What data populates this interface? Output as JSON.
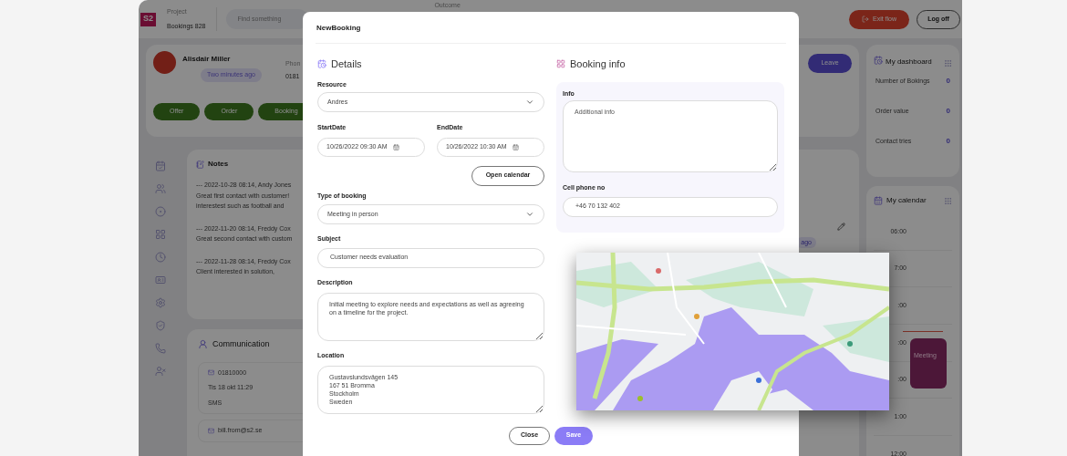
{
  "topbar": {
    "logo": "S2",
    "project_label": "Project",
    "project_name": "Bookings 828",
    "search": {
      "placeholder": "Find something"
    },
    "outcome_label": "Outcome",
    "exit_button": "Exit flow",
    "logoff_button": "Log off"
  },
  "customer": {
    "name": "Alisdair Miller",
    "badge": "Two minutes ago",
    "phone_label": "Phon",
    "phone": "0181",
    "leave_button": "Leave",
    "actions": [
      {
        "label": "Offer"
      },
      {
        "label": "Order"
      },
      {
        "label": "Booking"
      }
    ]
  },
  "notes": {
    "title": "Notes",
    "entries": [
      {
        "header": "--- 2022-10-28 08:14, Andy Jones",
        "lines": [
          "Great first contact with customer!",
          "interestest such as football and"
        ]
      },
      {
        "header": "--- 2022-11-20 08:14, Freddy Cox",
        "lines": [
          "Great second contact with custom"
        ]
      },
      {
        "header": "--- 2022-11-28 08:14, Freddy Cox",
        "lines": [
          "Client interested in solution,"
        ]
      }
    ]
  },
  "side_panel": {
    "badge": "ago"
  },
  "communication": {
    "title": "Communication",
    "items": [
      {
        "contact": "01810000",
        "time": "Tis 18 okt 11:29",
        "channel": "SMS"
      },
      {
        "contact": "bill.from@s2.se"
      }
    ]
  },
  "dashboard": {
    "title": "My dashboard",
    "stats": [
      {
        "label": "Number of Bokings",
        "value": "0"
      },
      {
        "label": "Order value",
        "value": "0"
      },
      {
        "label": "Contact tries",
        "value": "0"
      }
    ]
  },
  "calendar": {
    "title": "My calendar",
    "times": [
      "06:00",
      "7:00",
      ":00",
      ":00",
      ":00",
      "1:00",
      "12:00"
    ],
    "events": [
      {
        "title": "Meeting"
      }
    ]
  },
  "modal": {
    "title": "NewBooking",
    "details": {
      "heading": "Details",
      "resource": {
        "label": "Resource",
        "value": "Andres"
      },
      "start_date": {
        "label": "StartDate",
        "value": "10/26/2022 09:30 AM"
      },
      "end_date": {
        "label": "EndDate",
        "value": "10/26/2022 10:30 AM"
      },
      "open_calendar_button": "Open calendar",
      "booking_type": {
        "label": "Type of booking",
        "value": "Meeting in person"
      },
      "subject": {
        "label": "Subject",
        "value": "Customer needs evaluation"
      },
      "description": {
        "label": "Description",
        "value": "Initial meeting to explore needs and expectations as well as agreeing on a timeline for the project."
      },
      "location": {
        "label": "Location",
        "value": "Gustavslundsvägen 145\n167 51 Bromma\nStockholm\nSweden"
      }
    },
    "booking_info": {
      "heading": "Booking info",
      "info": {
        "label": "Info",
        "placeholder": "Additional info"
      },
      "cell_phone": {
        "label": "Cell phone no",
        "value": "+46 70 132 402"
      }
    },
    "buttons": [
      {
        "label": "Close",
        "kind": "secondary"
      },
      {
        "label": "Save",
        "kind": "primary"
      }
    ]
  }
}
